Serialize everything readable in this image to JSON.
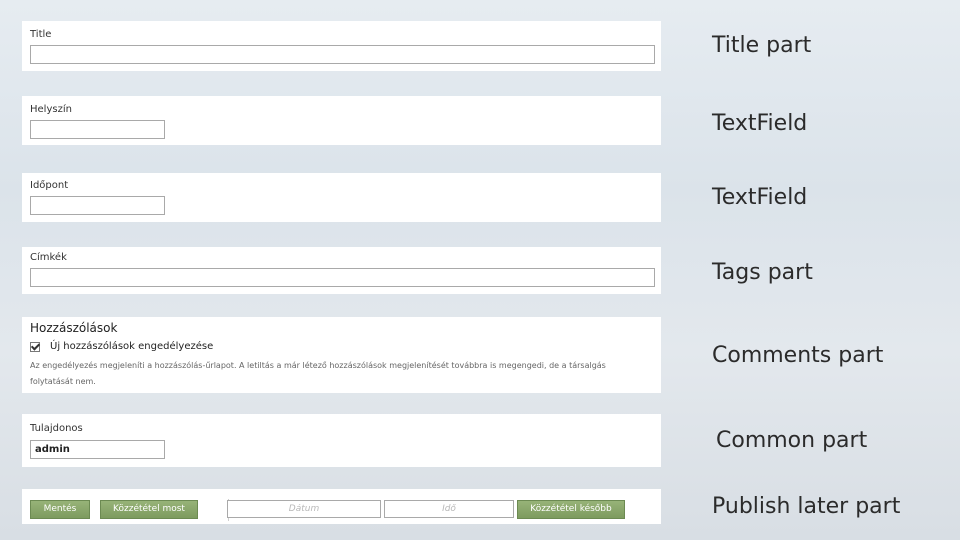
{
  "title_part": {
    "label": "Title",
    "value": "",
    "side_label": "Title part"
  },
  "location_part": {
    "label": "Helyszín",
    "value": "",
    "side_label": "TextField"
  },
  "time_part": {
    "label": "Időpont",
    "value": "",
    "side_label": "TextField"
  },
  "tags_part": {
    "label": "Címkék",
    "value": "",
    "side_label": "Tags part"
  },
  "comments_part": {
    "header": "Hozzászólások",
    "checkbox_label": "Új hozzászólások engedélyezése",
    "checkbox_checked": true,
    "description_line1": "Az engedélyezés megjeleníti a hozzászólás-űrlapot. A letiltás a már létező hozzászólások megjelenítését továbbra is megengedi, de a társalgás",
    "description_line2": "folytatását nem.",
    "side_label": "Comments part"
  },
  "common_part": {
    "label": "Tulajdonos",
    "owner_value": "admin",
    "side_label": "Common part"
  },
  "publish_part": {
    "save_label": "Mentés",
    "publish_now_label": "Közzététel most",
    "date_placeholder": "Dátum",
    "time_placeholder": "Idő",
    "publish_later_label": "Közzététel később",
    "side_label": "Publish later part"
  },
  "colors": {
    "button_green": "#7d9b5f",
    "panel_bg": "#ffffff",
    "page_bg": "#dbe3ea"
  }
}
